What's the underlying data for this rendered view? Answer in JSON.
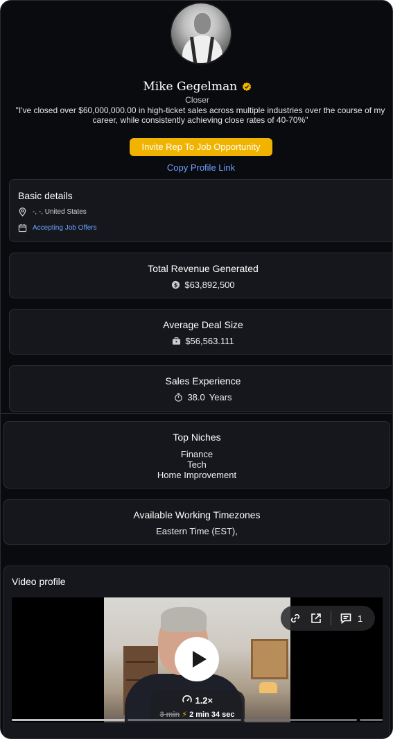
{
  "profile": {
    "name": "Mike Gegelman",
    "role": "Closer",
    "quote": "\"I've closed over $60,000,000.00 in high-ticket sales across multiple industries over the course of my career, while consistently achieving close rates of 40-70%\"",
    "verified": true
  },
  "actions": {
    "invite_label": "Invite Rep To Job Opportunity",
    "copy_link_label": "Copy Profile Link"
  },
  "basic_details": {
    "title": "Basic details",
    "location": "-, -, United States",
    "job_status": "Accepting Job Offers"
  },
  "stats": {
    "revenue_title": "Total Revenue Generated",
    "revenue_value": "$63,892,500",
    "deal_title": "Average Deal Size",
    "deal_value": "$56,563.111",
    "experience_title": "Sales Experience",
    "experience_value": "38.0",
    "experience_unit": "Years"
  },
  "niches": {
    "title": "Top Niches",
    "items": [
      "Finance",
      "Tech",
      "Home Improvement"
    ]
  },
  "timezones": {
    "title": "Available Working Timezones",
    "value": "Eastern Time (EST),"
  },
  "video": {
    "title": "Video profile",
    "comment_count": "1",
    "speed": "1.2×",
    "original_duration": "3 min",
    "fast_duration": "2 min 34 sec",
    "progress_fraction": 0.01
  },
  "colors": {
    "accent": "#f0b400",
    "link": "#6ea0ff",
    "background": "#0a0b0e",
    "card": "#15171c"
  }
}
